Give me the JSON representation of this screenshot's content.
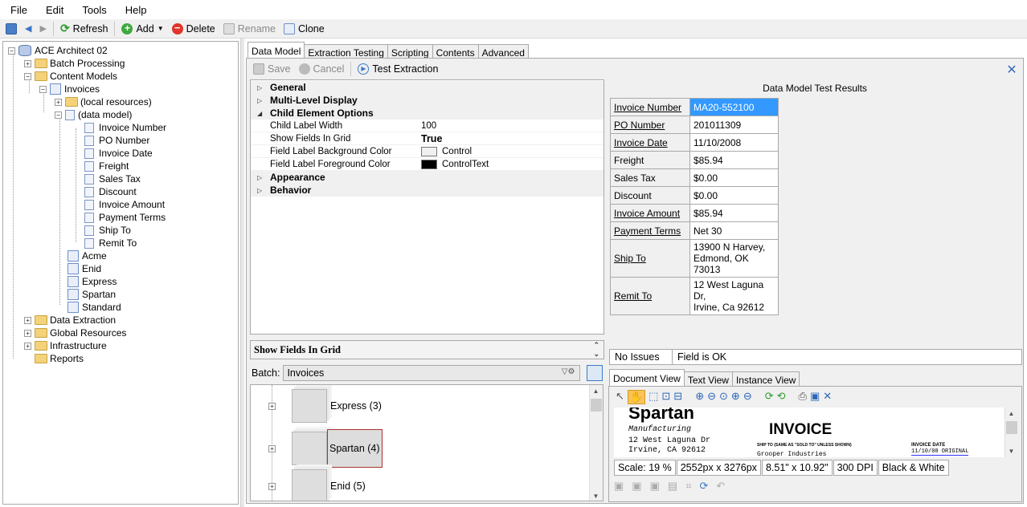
{
  "menu": [
    "File",
    "Edit",
    "Tools",
    "Help"
  ],
  "toolbar": {
    "refresh": "Refresh",
    "add": "Add",
    "delete": "Delete",
    "rename": "Rename",
    "clone": "Clone"
  },
  "tree": {
    "root": "ACE Architect 02",
    "batch_processing": "Batch Processing",
    "content_models": "Content Models",
    "invoices": "Invoices",
    "local_resources": "(local resources)",
    "data_model": "(data model)",
    "fields": [
      "Invoice Number",
      "PO Number",
      "Invoice Date",
      "Freight",
      "Sales Tax",
      "Discount",
      "Invoice Amount",
      "Payment Terms",
      "Ship To",
      "Remit To"
    ],
    "models": [
      "Acme",
      "Enid",
      "Express",
      "Spartan",
      "Standard"
    ],
    "data_extraction": "Data Extraction",
    "global_resources": "Global Resources",
    "infrastructure": "Infrastructure",
    "reports": "Reports"
  },
  "tabs": [
    "Data Model",
    "Extraction Testing",
    "Scripting",
    "Contents",
    "Advanced"
  ],
  "subtoolbar": {
    "save": "Save",
    "cancel": "Cancel",
    "test": "Test Extraction"
  },
  "property_grid": {
    "cat_general": "General",
    "cat_multilevel": "Multi-Level Display",
    "cat_child": "Child Element Options",
    "props": [
      {
        "name": "Child Label Width",
        "value": "100"
      },
      {
        "name": "Show Fields In Grid",
        "value": "True"
      },
      {
        "name": "Field Label Background Color",
        "value": "Control",
        "swatch": "#f0f0f0"
      },
      {
        "name": "Field Label Foreground Color",
        "value": "ControlText",
        "swatch": "#000000"
      }
    ],
    "cat_appearance": "Appearance",
    "cat_behavior": "Behavior",
    "description_title": "Show Fields In Grid"
  },
  "batch": {
    "label": "Batch:",
    "selected": "Invoices",
    "items": [
      "Express (3)",
      "Spartan (4)",
      "Enid (5)"
    ]
  },
  "results": {
    "title": "Data Model Test Results",
    "rows": [
      {
        "label": "Invoice Number",
        "value": "MA20-552100",
        "link": true,
        "selected": true
      },
      {
        "label": "PO Number",
        "value": "201011309",
        "link": true
      },
      {
        "label": "Invoice Date",
        "value": "11/10/2008",
        "link": true
      },
      {
        "label": "Freight",
        "value": "$85.94",
        "link": false
      },
      {
        "label": "Sales Tax",
        "value": "$0.00",
        "link": false
      },
      {
        "label": "Discount",
        "value": "$0.00",
        "link": false
      },
      {
        "label": "Invoice Amount",
        "value": "$85.94",
        "link": true
      },
      {
        "label": "Payment Terms",
        "value": "Net 30",
        "link": true
      },
      {
        "label": "Ship To",
        "value": "13900 N Harvey,\nEdmond, OK 73013",
        "link": true
      },
      {
        "label": "Remit To",
        "value": "12 West Laguna Dr,\nIrvine, Ca 92612",
        "link": true
      }
    ]
  },
  "status": {
    "issues": "No Issues",
    "message": "Field is OK"
  },
  "view_tabs": [
    "Document View",
    "Text View",
    "Instance View"
  ],
  "document": {
    "company": "Spartan",
    "sub": "Manufacturing",
    "addr1": "12 West Laguna Dr",
    "addr2": "Irvine, CA 92612",
    "heading": "INVOICE",
    "shipto": "SHIP TO (SAME AS \"SOLD TO\" UNLESS SHOWN)",
    "shipto_val": "Grooper Industries",
    "inv_date_label": "INVOICE DATE",
    "inv_date_val": "11/10/08 ORIGINAL"
  },
  "scale": [
    "Scale: 19 %",
    "2552px x 3276px",
    "8.51\" x 10.92\"",
    "300 DPI",
    "Black & White"
  ],
  "colors": {
    "selected": "#3399ff",
    "accent": "#1e73d2"
  }
}
